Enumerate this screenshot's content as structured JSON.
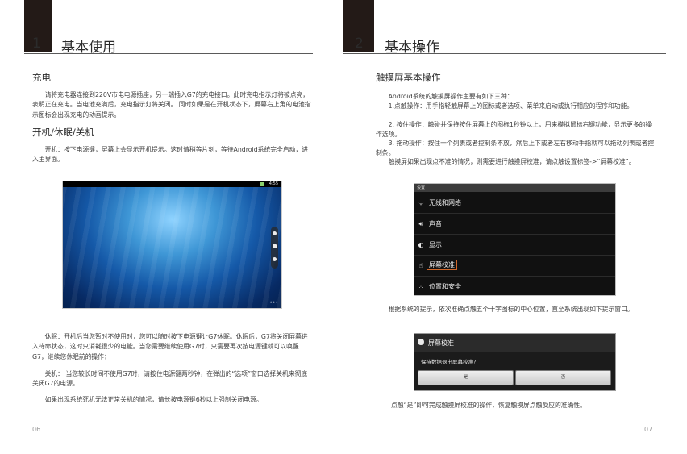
{
  "left_page": {
    "chapter_number": "1",
    "chapter_title": "基本使用",
    "heading_charging": "充电",
    "p_charging": "请将充电器连接到220V市电电源插座，另一端插入G7的充电接口。此时充电指示灯将被点亮，表明正在充电。当电池充满后，充电指示灯将关闭。 同时如果是在开机状态下，屏幕右上角的电池指示图标会出现充电的动画提示。",
    "heading_power": "开机/休眠/关机",
    "p_power_on": "开机：按下电源键，屏幕上会显示开机提示。这时请稍等片刻，等待Android系统完全启动，进入主界面。",
    "screenshot_time": "4:55",
    "p_sleep": "休眠：开机后当您暂时不使用时，您可以随时按下电源键让G7休眠。休眠后，G7将关闭屏幕进入待命状态，这时只消耗很少的电能。当您需要继续使用G7时，只需要再次按电源键就可以唤醒G7，继续您休眠前的操作；",
    "p_shutdown": "关机： 当您较长时间不使用G7时，请按住电源键两秒钟，在弹出的“选项”窗口选择关机来彻底关闭G7的电源。",
    "p_force": "如果出现系统死机无法正常关机的情况，请长按电源键6秒以上强制关闭电源。",
    "page_number": "06"
  },
  "right_page": {
    "chapter_number": "2",
    "chapter_title": "基本操作",
    "heading_touch": "触摸屏基本操作",
    "p_touch_intro": "Android系统的触摸屏操作主要有如下三种：",
    "p_touch_1": "1.点触操作：用手指轻触屏幕上的图标或者选项、菜单来启动或执行相应的程序和功能。",
    "p_touch_2": "2. 按住操作：触碰并保持按住屏幕上的图标1秒钟以上，用来模拟鼠标右键功能，显示更多的操作选项。",
    "p_touch_3": "3. 拖动操作：按住一个列表或者控制条不放，然后上下或者左右移动手指就可以拖动列表或者控制条。",
    "p_touch_calib": "触摸屏如果出现点不准的情况，则需要进行触摸屏校准，请点触设置标签->“屏幕校准”。",
    "settings": {
      "titlebar": "设置",
      "items": [
        {
          "icon": "wifi-icon",
          "label": "无线和网络"
        },
        {
          "icon": "speaker-icon",
          "label": "声音"
        },
        {
          "icon": "display-icon",
          "label": "显示"
        },
        {
          "icon": "hand-icon",
          "label": "屏幕校准"
        },
        {
          "icon": "grid-lock-icon",
          "label": "位置和安全"
        }
      ]
    },
    "p_prompt": "根据系统的提示，依次准确点触五个十字图标的中心位置，直至系统出现如下提示窗口。",
    "dialog": {
      "title": "屏幕校准",
      "message": "保持数据退出屏幕校准？",
      "ok": "是",
      "cancel": "否"
    },
    "p_finish": "点触“是”即可完成触摸屏校准的操作，恢复触摸屏点触反应的准确性。",
    "page_number": "07"
  },
  "colors": {
    "tab": "#231a17",
    "selected_outline": "#d0682b"
  }
}
